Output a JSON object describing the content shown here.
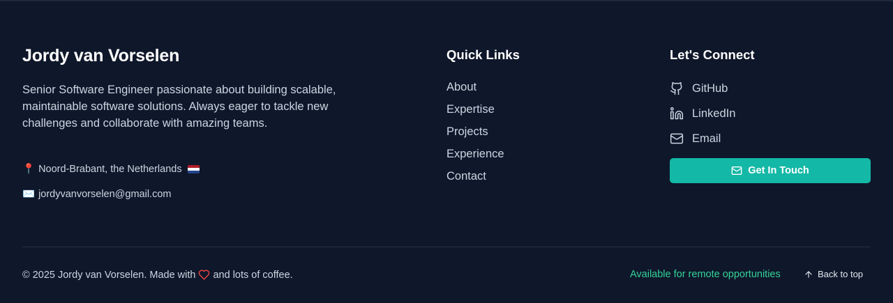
{
  "brand": {
    "name": "Jordy van Vorselen",
    "description": "Senior Software Engineer passionate about building scalable, maintainable software solutions. Always eager to tackle new challenges and collaborate with amazing teams.",
    "location_icon": "📍",
    "location": "Noord-Brabant, the Netherlands",
    "email_icon": "✉️",
    "email": "jordyvanvorselen@gmail.com"
  },
  "quick_links": {
    "title": "Quick Links",
    "items": [
      {
        "label": "About"
      },
      {
        "label": "Expertise"
      },
      {
        "label": "Projects"
      },
      {
        "label": "Experience"
      },
      {
        "label": "Contact"
      }
    ]
  },
  "connect": {
    "title": "Let's Connect",
    "items": [
      {
        "label": "GitHub",
        "icon": "github-icon"
      },
      {
        "label": "LinkedIn",
        "icon": "linkedin-icon"
      },
      {
        "label": "Email",
        "icon": "mail-icon"
      }
    ],
    "cta_label": "Get In Touch"
  },
  "footer": {
    "copyright_prefix": "© 2025 Jordy van Vorselen. Made with",
    "copyright_suffix": "and lots of coffee.",
    "available": "Available for remote opportunities",
    "back_to_top": "Back to top"
  },
  "colors": {
    "background": "#0f172a",
    "accent": "#14b8a6",
    "available": "#34d399",
    "heart": "#ef4444"
  }
}
